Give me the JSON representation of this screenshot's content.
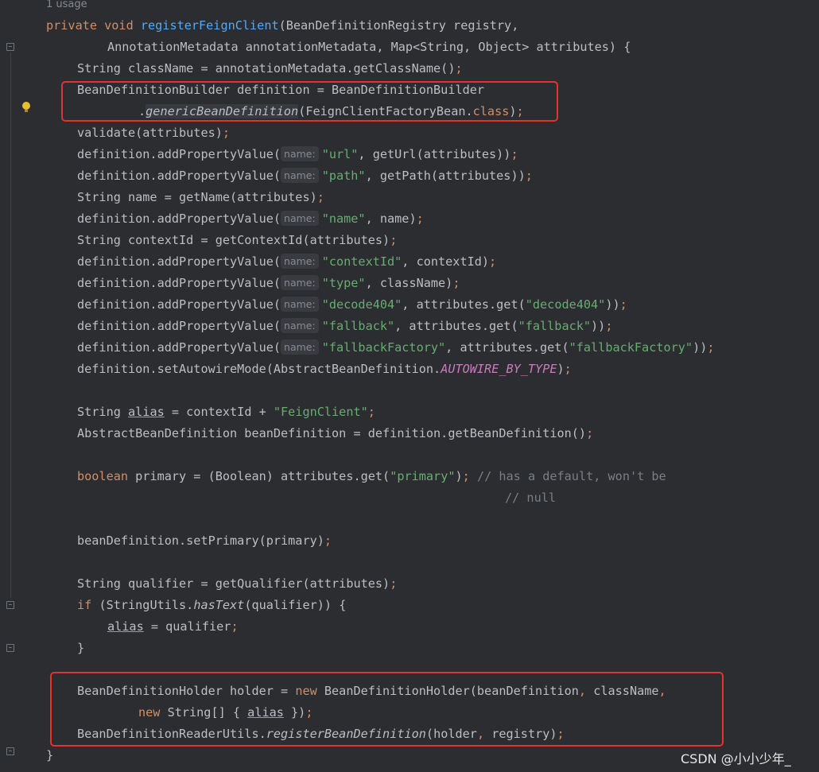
{
  "usage_hint": "1 usage",
  "param_hint": "name:",
  "watermark": "CSDN @小小少年_",
  "lines": {
    "l1": {
      "kw": "private void ",
      "fn": "registerFeignClient",
      "rest": "(BeanDefinitionRegistry registry,"
    },
    "l2": {
      "text": "AnnotationMetadata annotationMetadata, Map<String, Object> attributes) {"
    },
    "l3": {
      "a": "String className = annotationMetadata.getClassName()",
      "semi": ";"
    },
    "l4": {
      "text": "BeanDefinitionBuilder definition = BeanDefinitionBuilder"
    },
    "l5": {
      "dot": ".",
      "method": "genericBeanDefinition",
      "a": "(FeignClientFactoryBean.",
      "kw": "class",
      "b": ")",
      "semi": ";"
    },
    "l6": {
      "a": "validate(attributes)",
      "semi": ";"
    },
    "l7": {
      "a": "definition.addPropertyValue(",
      "s": "\"url\"",
      "b": ", getUrl(attributes))",
      "semi": ";"
    },
    "l8": {
      "a": "definition.addPropertyValue(",
      "s": "\"path\"",
      "b": ", getPath(attributes))",
      "semi": ";"
    },
    "l9": {
      "a": "String name = getName(attributes)",
      "semi": ";"
    },
    "l10": {
      "a": "definition.addPropertyValue(",
      "s": "\"name\"",
      "b": ", name)",
      "semi": ";"
    },
    "l11": {
      "a": "String contextId = getContextId(attributes)",
      "semi": ";"
    },
    "l12": {
      "a": "definition.addPropertyValue(",
      "s": "\"contextId\"",
      "b": ", contextId)",
      "semi": ";"
    },
    "l13": {
      "a": "definition.addPropertyValue(",
      "s": "\"type\"",
      "b": ", className)",
      "semi": ";"
    },
    "l14": {
      "a": "definition.addPropertyValue(",
      "s": "\"decode404\"",
      "b": ", attributes.get(",
      "s2": "\"decode404\"",
      "c": "))",
      "semi": ";"
    },
    "l15": {
      "a": "definition.addPropertyValue(",
      "s": "\"fallback\"",
      "b": ", attributes.get(",
      "s2": "\"fallback\"",
      "c": "))",
      "semi": ";"
    },
    "l16": {
      "a": "definition.addPropertyValue(",
      "s": "\"fallbackFactory\"",
      "b": ", attributes.get(",
      "s2": "\"fallbackFactory\"",
      "c": "))",
      "semi": ";"
    },
    "l17": {
      "a": "definition.setAutowireMode(AbstractBeanDefinition.",
      "const": "AUTOWIRE_BY_TYPE",
      "b": ")",
      "semi": ";"
    },
    "l18": {
      "a": "String ",
      "var": "alias",
      "b": " = contextId + ",
      "s": "\"FeignClient\"",
      "semi": ";"
    },
    "l19": {
      "a": "AbstractBeanDefinition beanDefinition = definition.getBeanDefinition()",
      "semi": ";"
    },
    "l20": {
      "kw": "boolean",
      "a": " primary = (Boolean) attributes.get(",
      "s": "\"primary\"",
      "b": ")",
      "semi": ";",
      "cmt": " // has a default, won't be"
    },
    "l21": {
      "cmt": "// null"
    },
    "l22": {
      "a": "beanDefinition.setPrimary(primary)",
      "semi": ";"
    },
    "l23": {
      "a": "String qualifier = getQualifier(attributes)",
      "semi": ";"
    },
    "l24": {
      "kw": "if",
      "a": " (StringUtils.",
      "method": "hasText",
      "b": "(qualifier)) {"
    },
    "l25": {
      "var": "alias",
      "a": " = qualifier",
      "semi": ";"
    },
    "l26": {
      "text": "}"
    },
    "l27": {
      "a": "BeanDefinitionHolder holder = ",
      "kw": "new",
      "b": " BeanDefinitionHolder(beanDefinition",
      "sep": ",",
      "c": " className",
      "sep2": ","
    },
    "l28": {
      "kw": "new",
      "a": " String[] { ",
      "var": "alias",
      "b": " })",
      "semi": ";"
    },
    "l29": {
      "a": "BeanDefinitionReaderUtils.",
      "method": "registerBeanDefinition",
      "b": "(holder",
      "sep": ",",
      "c": " registry)",
      "semi": ";"
    },
    "l30": {
      "text": "}"
    }
  }
}
